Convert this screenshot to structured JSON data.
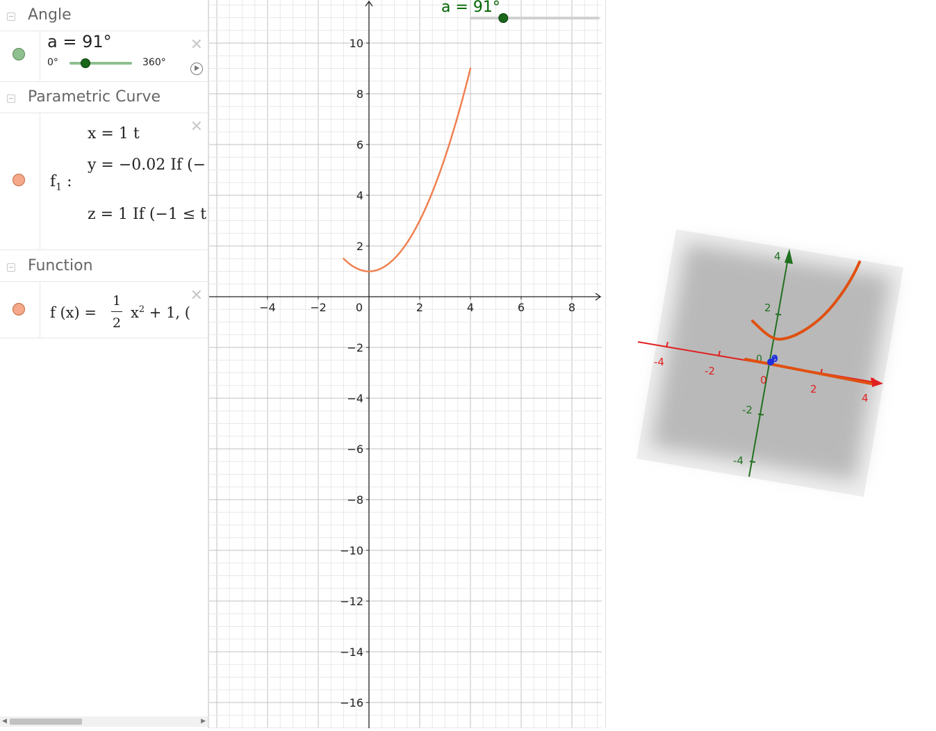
{
  "algebra": {
    "groups": [
      {
        "title": "Angle"
      },
      {
        "title": "Parametric Curve"
      },
      {
        "title": "Function"
      }
    ],
    "angle_item": {
      "label": "a = 91°",
      "min": "0°",
      "max": "360°",
      "value_fraction": 0.253,
      "marble_color": "#8fbf8f"
    },
    "curve_item": {
      "name": "f",
      "name_sub": "1",
      "name_colon": ":",
      "line_x": "x = 1 t",
      "line_y": "y = −0.02 If (−",
      "line_z": "z = 1 If (−1 ≤ t",
      "marble_color": "#f5a88a"
    },
    "function_item": {
      "lhs": "f (x)  =",
      "num": "1",
      "den": "2",
      "rest_base": "x",
      "rest_exp": "2",
      "rest_tail": " + 1,     (",
      "marble_color": "#f5a88a"
    },
    "close_symbol": "✕"
  },
  "graphics2d": {
    "slider_label": "a = 91°",
    "x_ticks": [
      "−4",
      "−2",
      "2",
      "4",
      "6",
      "8"
    ],
    "origin_label": "0",
    "y_ticks": [
      "10",
      "8",
      "6",
      "4",
      "2",
      "−2",
      "−4",
      "−6",
      "−8",
      "−10",
      "−12",
      "−14",
      "−16"
    ],
    "curve_color": "#f08050"
  },
  "graphics3d": {
    "red_ticks": [
      "-4",
      "-2",
      "0",
      "2",
      "4"
    ],
    "green_ticks": [
      "4",
      "2",
      "-2",
      "-4"
    ],
    "origin_label": "0",
    "blue_label": "0",
    "axis_x_color": "#e02020",
    "axis_y_color": "#207020",
    "curve_color": "#e05010"
  },
  "chart_data": {
    "type": "line",
    "title": "",
    "xlabel": "",
    "ylabel": "",
    "xlim": [
      -6.2,
      9.2
    ],
    "ylim": [
      -17,
      11.6
    ],
    "x_ticks": [
      -4,
      -2,
      0,
      2,
      4,
      6,
      8
    ],
    "y_ticks": [
      -16,
      -14,
      -12,
      -10,
      -8,
      -6,
      -4,
      -2,
      2,
      4,
      6,
      8,
      10
    ],
    "grid": true,
    "series": [
      {
        "x": [
          -1,
          -0.5,
          0,
          0.5,
          1,
          1.5,
          2,
          2.5,
          3,
          3.5,
          4
        ],
        "y": [
          1.5,
          1.125,
          1,
          1.125,
          1.5,
          2.125,
          3,
          4.125,
          5.5,
          7.125,
          9
        ]
      }
    ]
  }
}
